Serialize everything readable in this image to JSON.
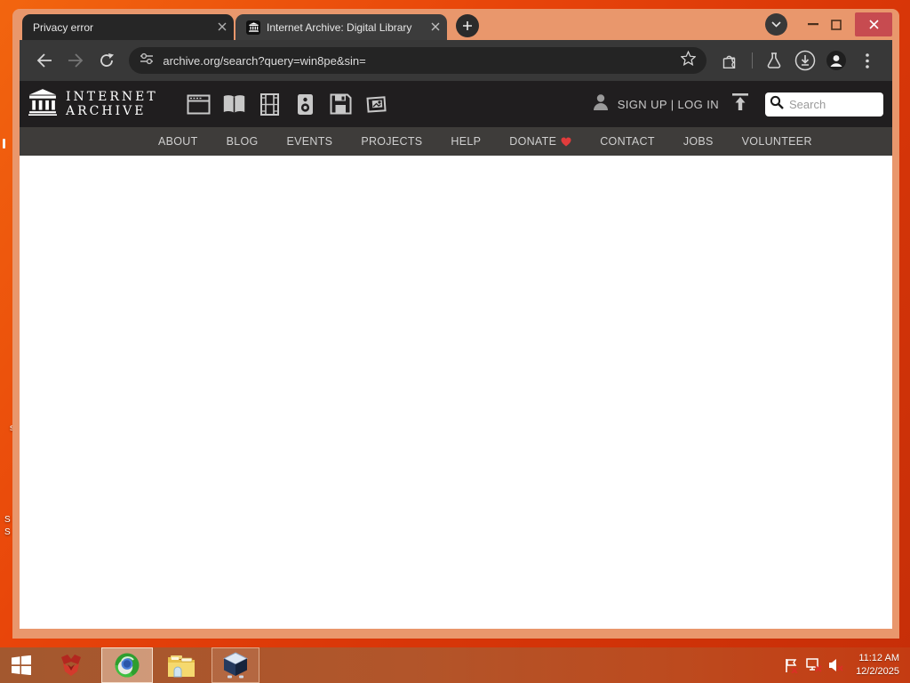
{
  "browser": {
    "tabs": [
      {
        "title": "Privacy error",
        "active": false
      },
      {
        "title": "Internet Archive: Digital Library",
        "active": true
      }
    ],
    "url": "archive.org/search?query=win8pe&sin="
  },
  "ia_header": {
    "logo_line1": "INTERNET",
    "logo_line2": "ARCHIVE",
    "signup_login": "SIGN UP | LOG IN",
    "search_placeholder": "Search"
  },
  "nav": {
    "items": [
      "ABOUT",
      "BLOG",
      "EVENTS",
      "PROJECTS",
      "HELP",
      "DONATE",
      "CONTACT",
      "JOBS",
      "VOLUNTEER"
    ]
  },
  "taskbar": {
    "time": "11:12 AM",
    "date": "12/2/2025"
  },
  "desktop": {
    "edge_marks": [
      "s",
      "S",
      "S"
    ]
  },
  "colors": {
    "desktop_orange": "#e8450a",
    "frame_salmon": "#e9976c",
    "chrome_dark": "#383838",
    "ia_header_dark": "#201e1f",
    "close_button_red": "#c74b50",
    "donate_heart": "#e03c3c"
  }
}
